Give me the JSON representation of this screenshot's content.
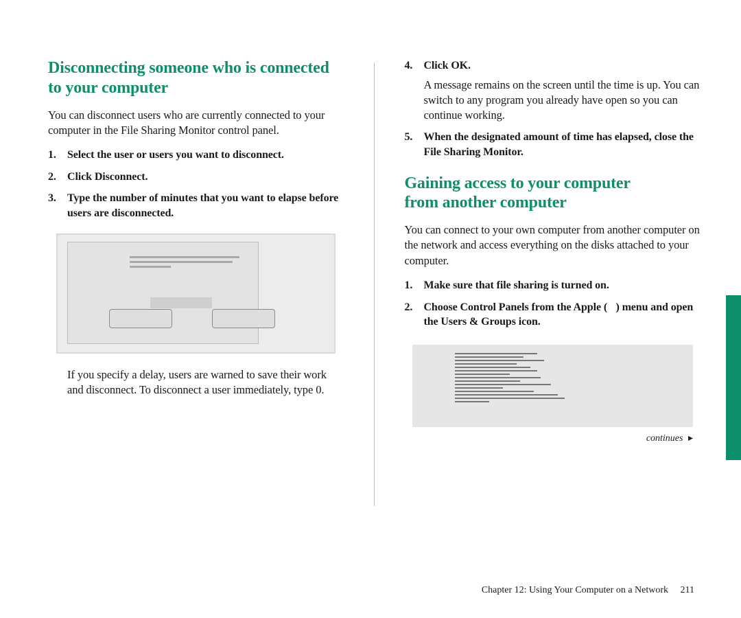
{
  "left": {
    "heading": "Disconnecting someone who is connected to your computer",
    "intro": "You can disconnect users who are currently connected to your computer in the File Sharing Monitor control panel.",
    "steps": [
      "Select the user or users you want to disconnect.",
      "Click Disconnect.",
      "Type the number of minutes that you want to elapse before users are disconnected."
    ],
    "after_figure": "If you specify a delay, users are warned to save their work and disconnect. To disconnect a user immediately, type 0."
  },
  "right": {
    "step4_label": "Click OK.",
    "step4_body": "A message remains on the screen until the time is up. You can switch to any program you already have open so you can continue working.",
    "step5_label": "When the designated amount of time has elapsed, close the File Sharing Monitor.",
    "heading": "Gaining access to your computer from another computer",
    "intro": "You can connect to your own computer from another computer on the network and access everything on the disks attached to your computer.",
    "steps_b": {
      "s1": "Make sure that file sharing is turned on.",
      "s2_pre": "Choose Control Panels from the Apple (",
      "s2_icon": "",
      "s2_post": ") menu and open the Users & Groups icon."
    },
    "continues": "continues",
    "continues_arrow": "▸"
  },
  "footer": {
    "chapter": "Chapter 12: Using Your Computer on a Network",
    "page": "211"
  }
}
